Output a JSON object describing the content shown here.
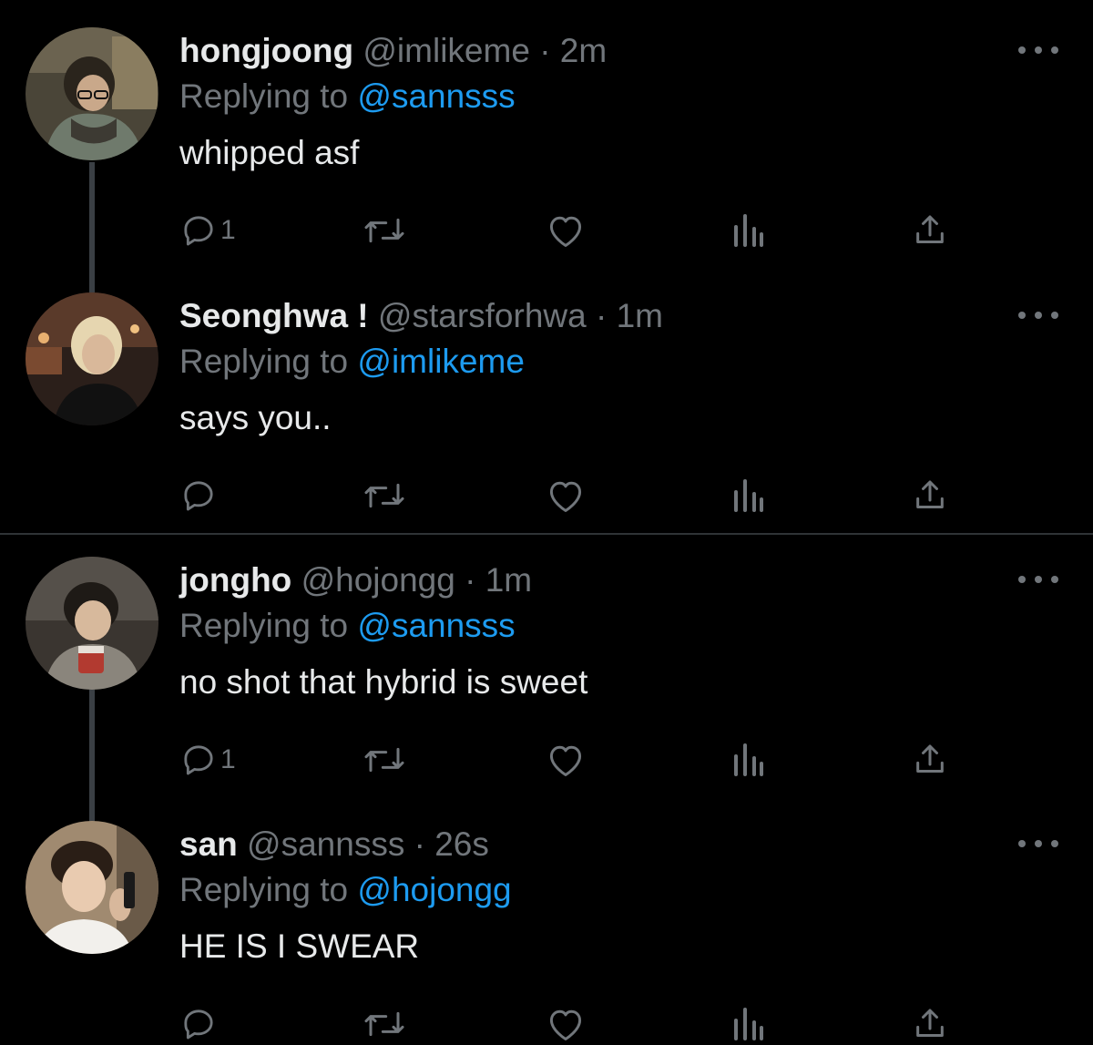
{
  "tweets": [
    {
      "display_name": "hongjoong",
      "handle": "@imlikeme",
      "separator": "·",
      "time": "2m",
      "replying_prefix": "Replying to",
      "replying_to": "@sannsss",
      "text": "whipped asf",
      "reply_count": "1",
      "avatar_icon": "avatar-photo"
    },
    {
      "display_name": "Seonghwa !",
      "handle": "@starsforhwa",
      "separator": "·",
      "time": "1m",
      "replying_prefix": "Replying to",
      "replying_to": "@imlikeme",
      "text": "says you..",
      "reply_count": "",
      "avatar_icon": "avatar-photo"
    },
    {
      "display_name": "jongho",
      "handle": "@hojongg",
      "separator": "·",
      "time": "1m",
      "replying_prefix": "Replying to",
      "replying_to": "@sannsss",
      "text": "no shot that hybrid is sweet",
      "reply_count": "1",
      "avatar_icon": "avatar-photo"
    },
    {
      "display_name": "san",
      "handle": "@sannsss",
      "separator": "·",
      "time": "26s",
      "replying_prefix": "Replying to",
      "replying_to": "@hojongg",
      "text": "HE IS I SWEAR",
      "reply_count": "",
      "avatar_icon": "avatar-photo"
    }
  ],
  "icons": {
    "reply": "reply-icon",
    "retweet": "retweet-icon",
    "like": "heart-icon",
    "views": "views-icon",
    "share": "share-icon",
    "more": "more-icon"
  },
  "colors": {
    "background": "#000000",
    "text": "#e7e9ea",
    "muted": "#71767b",
    "link": "#1d9bf0",
    "thread_line": "#3a3f44",
    "divider": "#2f3336"
  }
}
